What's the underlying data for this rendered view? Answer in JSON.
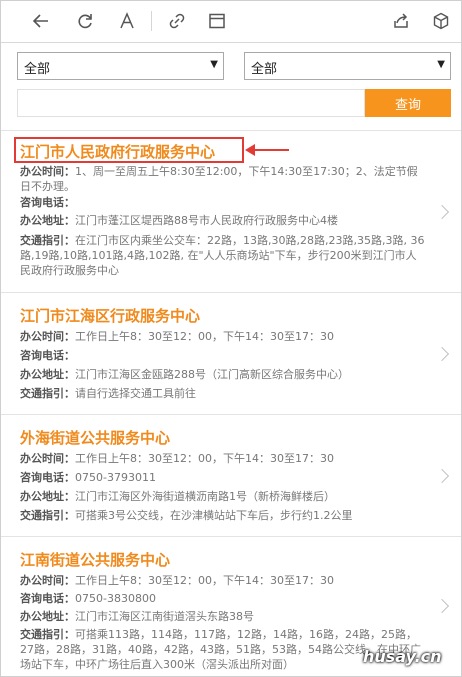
{
  "toolbar": {
    "icons": [
      "back-icon",
      "refresh-icon",
      "font-size-icon",
      "link-icon",
      "window-icon",
      "share-icon",
      "cube-icon"
    ]
  },
  "filters": {
    "select1": "全部",
    "select2": "全部",
    "search_placeholder": "",
    "search_button": "查询"
  },
  "items": [
    {
      "title": "江门市人民政府行政服务中心",
      "hours_label": "办公时间：",
      "hours": "1、周一至周五上午8:30至12:00，下午14:30至17:30；2、法定节假日不办理。",
      "phone_label": "咨询电话：",
      "phone": "",
      "address_label": "办公地址：",
      "address": "江门市蓬江区堤西路88号市人民政府行政服务中心4楼",
      "traffic_label": "交通指引：",
      "traffic": "在江门市区内乘坐公交车：22路，13路,30路,28路,23路,35路,3路, 36路,19路,10路,101路,4路,102路, 在\"人人乐商场站\"下车，步行200米到江门市人民政府行政服务中心"
    },
    {
      "title": "江门市江海区行政服务中心",
      "hours_label": "办公时间：",
      "hours": "工作日上午8：30至12：00，下午14：30至17：30",
      "phone_label": "咨询电话：",
      "phone": "",
      "address_label": "办公地址：",
      "address": "江门市江海区金瓯路288号（江门高新区综合服务中心）",
      "traffic_label": "交通指引：",
      "traffic": "请自行选择交通工具前往"
    },
    {
      "title": "外海街道公共服务中心",
      "hours_label": "办公时间：",
      "hours": "工作日上午8：30至12：00，下午14：30至17：30",
      "phone_label": "咨询电话：",
      "phone": "0750-3793011",
      "address_label": "办公地址：",
      "address": "江门市江海区外海街道横沥南路1号（新桥海鲜楼后）",
      "traffic_label": "交通指引：",
      "traffic": "可搭乘3号公交线，在沙津横站站下车后，步行约1.2公里"
    },
    {
      "title": "江南街道公共服务中心",
      "hours_label": "办公时间：",
      "hours": "工作日上午8：30至12：00，下午14：30至17：30",
      "phone_label": "咨询电话：",
      "phone": "0750-3830800",
      "address_label": "办公地址：",
      "address": "江门市江海区江南街道滘头东路38号",
      "traffic_label": "交通指引：",
      "traffic": "可搭乘113路，114路，117路，12路，14路，16路，24路，25路，27路，28路，31路，40路，42路，43路，51路，53路，54路公交线，在中环广场站下车，中环广场往后直入300米（滘头派出所对面）"
    }
  ],
  "watermark": "husay.cn",
  "colors": {
    "accent": "#f7941d",
    "title": "#f08a1c",
    "annotation": "#e23a34"
  }
}
